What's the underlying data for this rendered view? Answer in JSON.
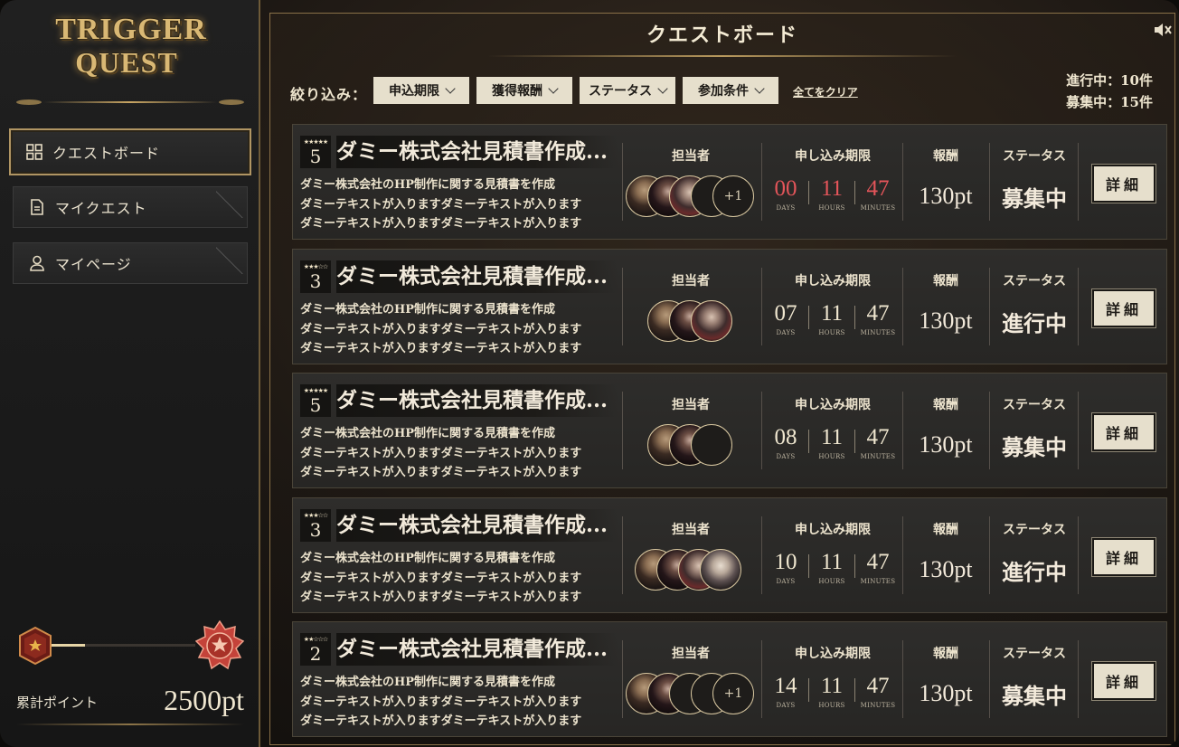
{
  "logo": {
    "line1": "TRIGGER",
    "line2": "QUEST"
  },
  "sidebar": {
    "items": [
      {
        "label": "クエストボード",
        "icon": "grid-icon",
        "active": true
      },
      {
        "label": "マイクエスト",
        "icon": "document-icon",
        "active": false
      },
      {
        "label": "マイページ",
        "icon": "user-icon",
        "active": false
      }
    ],
    "rank_progress": 0.24,
    "points_label": "累計ポイント",
    "points_value": "2500pt"
  },
  "header": {
    "title": "クエストボード",
    "sound_icon": "speaker-muted-icon"
  },
  "filters": {
    "label": "絞り込み：",
    "buttons": [
      "申込期限",
      "獲得報酬",
      "ステータス",
      "参加条件"
    ],
    "clear_label": "全てをクリア"
  },
  "counts": {
    "in_progress": "進行中：10件",
    "recruiting": "募集中：15件"
  },
  "columns": {
    "assignee": "担当者",
    "deadline": "申し込み期限",
    "reward": "報酬",
    "status": "ステータス"
  },
  "timer_units": {
    "days": "DAYS",
    "hours": "HOURS",
    "minutes": "MINUTES"
  },
  "detail_label": "詳細",
  "colors": {
    "accent_gold": "#b09563",
    "urgent_red": "#e4555a",
    "button_bg": "#e6dfcc"
  },
  "quests": [
    {
      "level": "5",
      "stars": "★★★★★",
      "title": "ダミー株式会社見積書作成...",
      "desc": [
        "ダミー株式会社のHP制作に関する見積書を作成",
        "ダミーテキストが入りますダミーテキストが入ります",
        "ダミーテキストが入りますダミーテキストが入ります"
      ],
      "avatars": [
        "p1",
        "p2",
        "p3",
        "empty"
      ],
      "extra": "+1",
      "days": "00",
      "hours": "11",
      "minutes": "47",
      "urgent": true,
      "reward": "130pt",
      "status": "募集中"
    },
    {
      "level": "3",
      "stars": "★★★☆☆",
      "title": "ダミー株式会社見積書作成...",
      "desc": [
        "ダミー株式会社のHP制作に関する見積書を作成",
        "ダミーテキストが入りますダミーテキストが入ります",
        "ダミーテキストが入りますダミーテキストが入ります"
      ],
      "avatars": [
        "p1",
        "p2",
        "p3"
      ],
      "extra": "",
      "days": "07",
      "hours": "11",
      "minutes": "47",
      "urgent": false,
      "reward": "130pt",
      "status": "進行中"
    },
    {
      "level": "5",
      "stars": "★★★★★",
      "title": "ダミー株式会社見積書作成...",
      "desc": [
        "ダミー株式会社のHP制作に関する見積書を作成",
        "ダミーテキストが入りますダミーテキストが入ります",
        "ダミーテキストが入りますダミーテキストが入ります"
      ],
      "avatars": [
        "p1",
        "p2",
        "empty"
      ],
      "extra": "",
      "days": "08",
      "hours": "11",
      "minutes": "47",
      "urgent": false,
      "reward": "130pt",
      "status": "募集中"
    },
    {
      "level": "3",
      "stars": "★★★☆☆",
      "title": "ダミー株式会社見積書作成...",
      "desc": [
        "ダミー株式会社のHP制作に関する見積書を作成",
        "ダミーテキストが入りますダミーテキストが入ります",
        "ダミーテキストが入りますダミーテキストが入ります"
      ],
      "avatars": [
        "p1",
        "p2",
        "p3",
        "p4"
      ],
      "extra": "",
      "days": "10",
      "hours": "11",
      "minutes": "47",
      "urgent": false,
      "reward": "130pt",
      "status": "進行中"
    },
    {
      "level": "2",
      "stars": "★★☆☆☆",
      "title": "ダミー株式会社見積書作成...",
      "desc": [
        "ダミー株式会社のHP制作に関する見積書を作成",
        "ダミーテキストが入りますダミーテキストが入ります",
        "ダミーテキストが入りますダミーテキストが入ります"
      ],
      "avatars": [
        "p1",
        "p2",
        "empty",
        "empty"
      ],
      "extra": "+1",
      "days": "14",
      "hours": "11",
      "minutes": "47",
      "urgent": false,
      "reward": "130pt",
      "status": "募集中"
    }
  ]
}
